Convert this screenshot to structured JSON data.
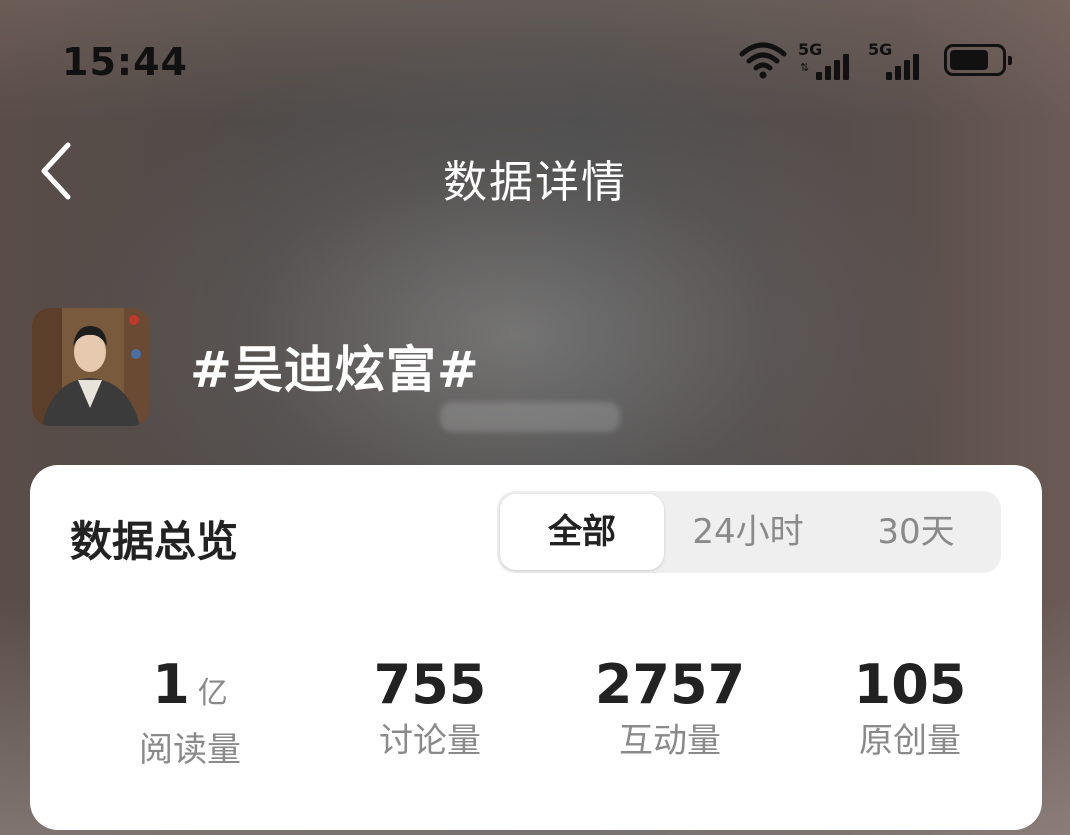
{
  "status_bar": {
    "time": "15:44",
    "network1_label": "5G",
    "network2_label": "5G"
  },
  "nav": {
    "title": "数据详情",
    "back_icon": "chevron-left-icon"
  },
  "topic": {
    "title": "#吴迪炫富#"
  },
  "card": {
    "title": "数据总览",
    "tabs": [
      {
        "label": "全部",
        "active": true
      },
      {
        "label": "24小时",
        "active": false
      },
      {
        "label": "30天",
        "active": false
      }
    ],
    "stats": [
      {
        "value": "1",
        "unit": "亿",
        "label": "阅读量"
      },
      {
        "value": "755",
        "unit": "",
        "label": "讨论量"
      },
      {
        "value": "2757",
        "unit": "",
        "label": "互动量"
      },
      {
        "value": "105",
        "unit": "",
        "label": "原创量"
      }
    ]
  },
  "colors": {
    "card_bg": "#ffffff",
    "primary_text": "#222222",
    "secondary_text": "#8a8a8a",
    "segment_bg": "#efefef"
  }
}
